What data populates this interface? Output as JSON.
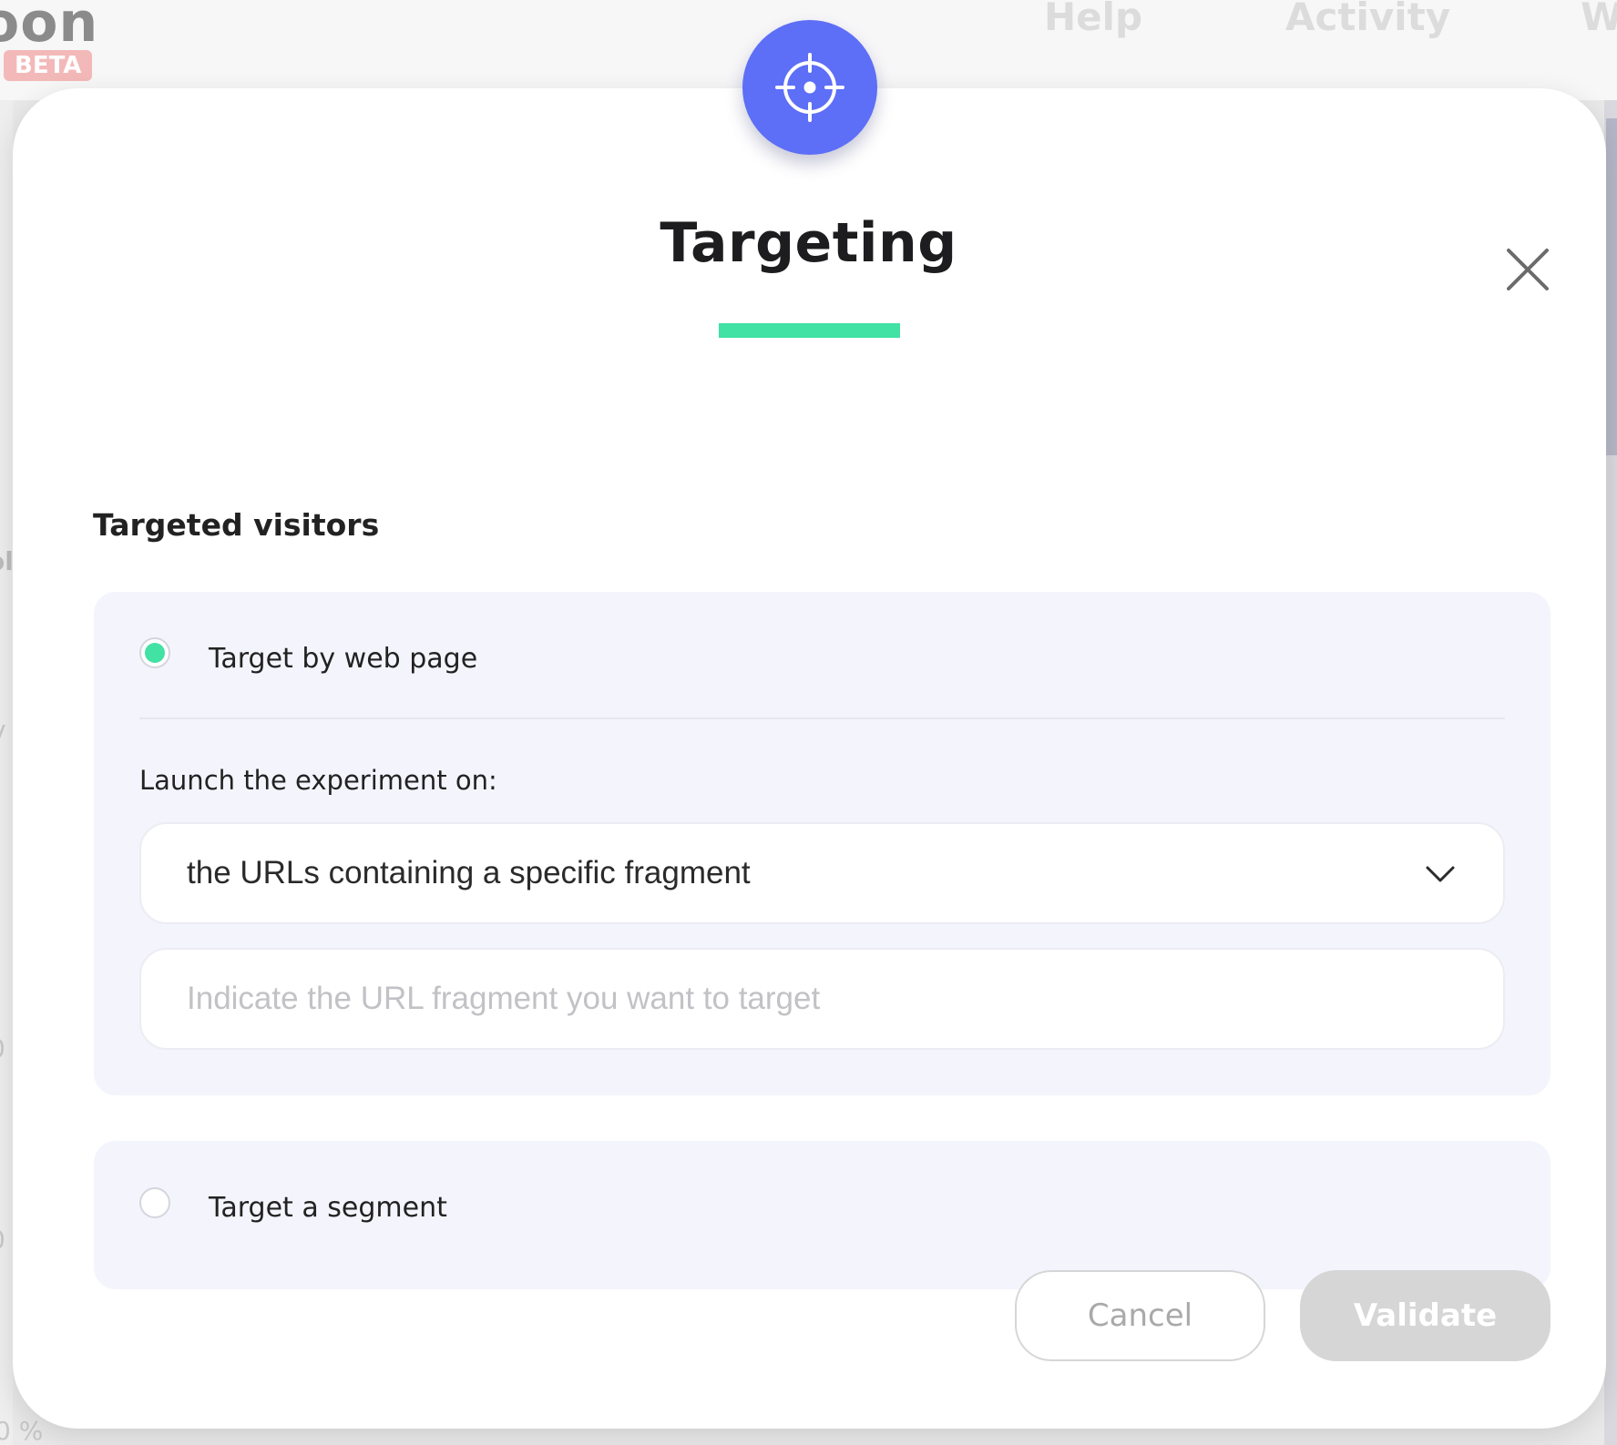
{
  "background": {
    "logo_fragment": "oon",
    "beta_badge": "BETA",
    "nav": [
      "Help",
      "Activity",
      "W"
    ],
    "left_fragments": [
      "ol",
      "v",
      "0",
      "0",
      "0 %"
    ]
  },
  "modal": {
    "badge_icon": "crosshair-icon",
    "title": "Targeting",
    "close_icon": "close-icon",
    "section_heading": "Targeted visitors",
    "options": [
      {
        "label": "Target by web page",
        "selected": true,
        "field_label": "Launch the experiment on:",
        "select_value": "the URLs containing a specific fragment",
        "input_value": "",
        "input_placeholder": "Indicate the URL fragment you want to target"
      },
      {
        "label": "Target a segment",
        "selected": false
      }
    ],
    "buttons": {
      "cancel": "Cancel",
      "validate": "Validate"
    }
  },
  "colors": {
    "accent": "#5d6ef7",
    "success": "#42e1a4",
    "card_bg": "#f4f4fd",
    "disabled": "#d6d6d6"
  }
}
